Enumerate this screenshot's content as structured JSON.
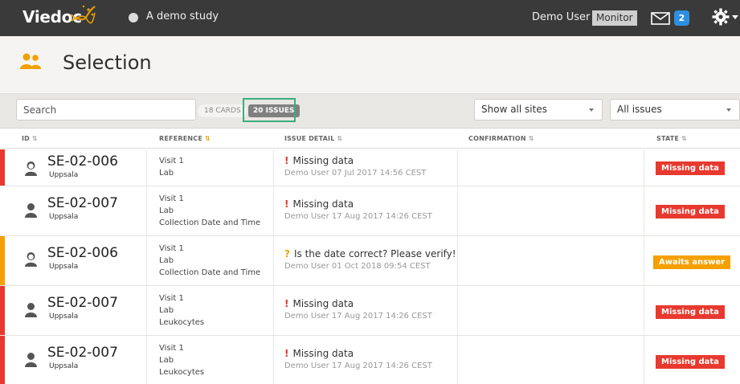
{
  "topbar": {
    "logo": "Viedoc",
    "study_name": "A demo study",
    "user_name": "Demo User",
    "role": "Monitor",
    "message_count": "2"
  },
  "page": {
    "title": "Selection"
  },
  "filters": {
    "search_placeholder": "Search",
    "cards_label": "18 CARDS",
    "issues_label": "20 ISSUES",
    "sites_select": "Show all sites",
    "issues_select": "All issues"
  },
  "columns": [
    "ID",
    "REFERENCE",
    "ISSUE DETAIL",
    "CONFIRMATION",
    "STATE"
  ],
  "rows": [
    {
      "subject_id": "SE-02-006",
      "site": "Uppsala",
      "reference": [
        "Visit 1",
        "Lab"
      ],
      "issue_mark": "!",
      "issue_title": "Missing data",
      "issue_meta": "Demo User 07 Jul 2017 14:56 CEST",
      "confirmation": "",
      "state": "Missing data",
      "accent_color": "#e8392f",
      "state_color": "red",
      "avatar": "female-avatar-icon"
    },
    {
      "subject_id": "SE-02-007",
      "site": "Uppsala",
      "reference": [
        "Visit 1",
        "Lab",
        "Collection Date and Time"
      ],
      "issue_mark": "!",
      "issue_title": "Missing data",
      "issue_meta": "Demo User 17 Aug 2017 14:26 CEST",
      "confirmation": "",
      "state": "Missing data",
      "accent_color": "#ffffff",
      "state_color": "red",
      "avatar": "male-avatar-icon"
    },
    {
      "subject_id": "SE-02-006",
      "site": "Uppsala",
      "reference": [
        "Visit 1",
        "Lab",
        "Collection Date and Time"
      ],
      "issue_mark": "?",
      "issue_title": "Is the date correct? Please verify!",
      "issue_meta": "Demo User 01 Oct 2018 09:54 CEST",
      "confirmation": "",
      "state": "Awaits answer",
      "accent_color": "#f5a000",
      "state_color": "orange",
      "avatar": "female-avatar-icon"
    },
    {
      "subject_id": "SE-02-007",
      "site": "Uppsala",
      "reference": [
        "Visit 1",
        "Lab",
        "Leukocytes"
      ],
      "issue_mark": "!",
      "issue_title": "Missing data",
      "issue_meta": "Demo User 17 Aug 2017 14:26 CEST",
      "confirmation": "",
      "state": "Missing data",
      "accent_color": "#e8392f",
      "state_color": "red",
      "avatar": "male-avatar-icon"
    },
    {
      "subject_id": "SE-02-007",
      "site": "Uppsala",
      "reference": [
        "Visit 1",
        "Lab",
        "Leukocytes"
      ],
      "issue_mark": "!",
      "issue_title": "Missing data",
      "issue_meta": "Demo User 17 Aug 2017 14:26 CEST",
      "confirmation": "",
      "state": "Missing data",
      "accent_color": "#e8392f",
      "state_color": "red",
      "avatar": "male-avatar-icon"
    }
  ],
  "colors": {
    "topbar": "#3a3a3a",
    "accent_orange": "#f5a000",
    "missing_red": "#e8392f",
    "highlight_green": "#3aae7b"
  }
}
